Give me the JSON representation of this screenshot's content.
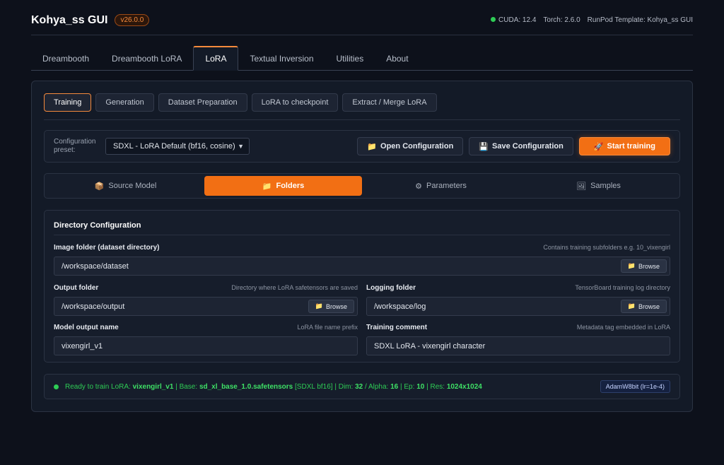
{
  "header": {
    "title": "Kohya_ss GUI",
    "version": "v26.0.0",
    "cuda": "CUDA: 12.4",
    "torch": "Torch: 2.6.0",
    "template": "RunPod Template: Kohya_ss GUI"
  },
  "tabs": [
    "Dreambooth",
    "Dreambooth LoRA",
    "LoRA",
    "Textual Inversion",
    "Utilities",
    "About"
  ],
  "subtabs": [
    "Training",
    "Generation",
    "Dataset Preparation",
    "LoRA to checkpoint",
    "Extract / Merge LoRA"
  ],
  "config": {
    "label_line1": "Configuration",
    "label_line2": "preset:",
    "preset_value": "SDXL - LoRA Default (bf16, cosine)",
    "open_label": "Open Configuration",
    "save_label": "Save Configuration",
    "start_label": "Start training"
  },
  "section_tabs": [
    "Source Model",
    "Folders",
    "Parameters",
    "Samples"
  ],
  "directory": {
    "title": "Directory Configuration",
    "browse_label": "Browse",
    "image_folder": {
      "label": "Image folder (dataset directory)",
      "hint": "Contains training subfolders e.g. 10_vixengirl",
      "value": "/workspace/dataset"
    },
    "output_folder": {
      "label": "Output folder",
      "hint": "Directory where LoRA safetensors are saved",
      "value": "/workspace/output"
    },
    "logging_folder": {
      "label": "Logging folder",
      "hint": "TensorBoard training log directory",
      "value": "/workspace/log"
    },
    "model_output_name": {
      "label": "Model output name",
      "hint": "LoRA file name prefix",
      "value": "vixengirl_v1"
    },
    "training_comment": {
      "label": "Training comment",
      "hint": "Metadata tag embedded in LoRA",
      "value": "SDXL LoRA - vixengirl character"
    }
  },
  "status": {
    "prefix": "Ready to train LoRA: ",
    "name": "vixengirl_v1",
    "base_prefix": " | Base: ",
    "base": "sd_xl_base_1.0.safetensors",
    "base_suffix": " [SDXL bf16] | Dim: ",
    "dim": "32",
    "alpha_prefix": " / Alpha: ",
    "alpha": "16",
    "ep_prefix": " | Ep: ",
    "ep": "10",
    "res_prefix": " | Res: ",
    "res": "1024x1024",
    "optimizer": "AdamW8bit (lr=1e-4)"
  },
  "colors": {
    "accent": "#f26f14",
    "status_green": "#2ecc55",
    "background": "#0d111b"
  },
  "icons": {
    "source_model": "package-icon",
    "folders": "folder-icon",
    "parameters": "gear-icon",
    "samples": "image-icon",
    "save": "floppy-icon",
    "start": "rocket-icon"
  }
}
